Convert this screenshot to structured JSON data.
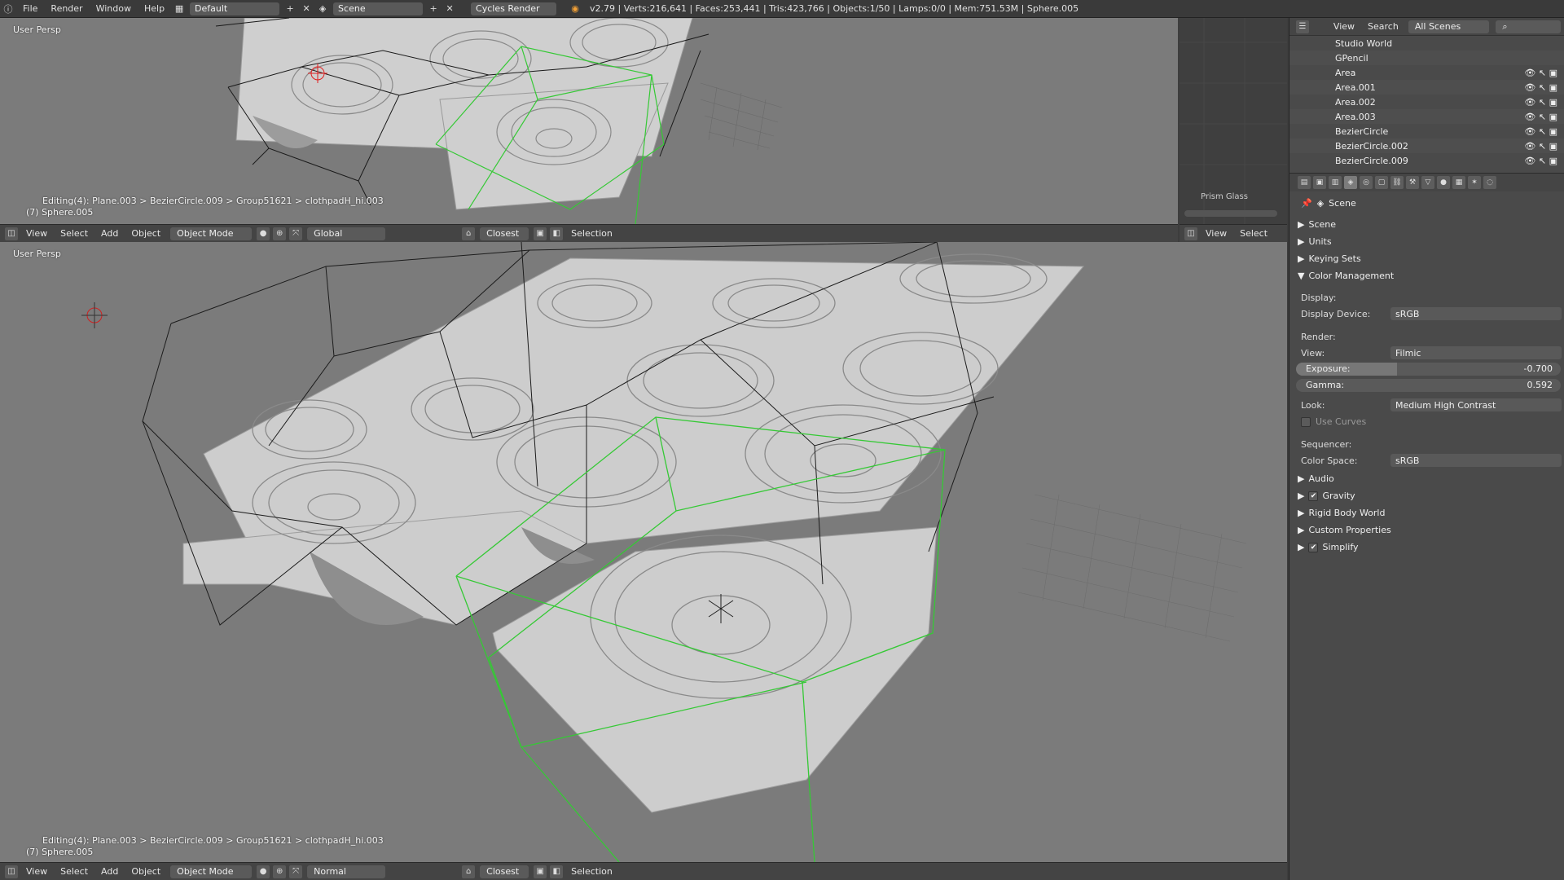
{
  "topbar": {
    "menus": [
      "File",
      "Render",
      "Window",
      "Help"
    ],
    "layout": "Default",
    "scene": "Scene",
    "engine": "Cycles Render",
    "stats": "v2.79 | Verts:216,641 | Faces:253,441 | Tris:423,766 | Objects:1/50 | Lamps:0/0 | Mem:751.53M | Sphere.005"
  },
  "viewport_top": {
    "label": "User Persp",
    "status_line1": "Editing(4): Plane.003 > BezierCircle.009 > Group51621 > clothpadH_hi.003",
    "status_line2": "(7) Sphere.005",
    "header": {
      "view": "View",
      "select": "Select",
      "add": "Add",
      "object": "Object",
      "mode": "Object Mode",
      "orientation": "Global",
      "snap": "Closest",
      "selection": "Selection"
    }
  },
  "viewport_bottom": {
    "label": "User Persp",
    "status_line1": "Editing(4): Plane.003 > BezierCircle.009 > Group51621 > clothpadH_hi.003",
    "status_line2": "(7) Sphere.005",
    "header": {
      "view": "View",
      "select": "Select",
      "add": "Add",
      "object": "Object",
      "mode": "Object Mode",
      "orientation": "Normal",
      "snap": "Closest",
      "selection": "Selection"
    }
  },
  "sideview": {
    "label": "Prism Glass",
    "header_view": "View",
    "header_select": "Select"
  },
  "outliner": {
    "header_view": "View",
    "header_search": "Search",
    "header_scope": "All Scenes",
    "items": [
      {
        "name": "Studio World"
      },
      {
        "name": "GPencil"
      },
      {
        "name": "Area"
      },
      {
        "name": "Area.001"
      },
      {
        "name": "Area.002"
      },
      {
        "name": "Area.003"
      },
      {
        "name": "BezierCircle"
      },
      {
        "name": "BezierCircle.002"
      },
      {
        "name": "BezierCircle.009"
      }
    ]
  },
  "properties": {
    "context": "Scene",
    "panels": {
      "scene": "Scene",
      "units": "Units",
      "keying_sets": "Keying Sets",
      "color_management": "Color Management",
      "audio": "Audio",
      "gravity": "Gravity",
      "rigid_body_world": "Rigid Body World",
      "custom_properties": "Custom Properties",
      "simplify": "Simplify"
    },
    "display_label": "Display:",
    "display_device_label": "Display Device:",
    "display_device": "sRGB",
    "render_label": "Render:",
    "view_label": "View:",
    "view": "Filmic",
    "exposure_label": "Exposure:",
    "exposure": "-0.700",
    "exposure_fill": 0.38,
    "gamma_label": "Gamma:",
    "gamma": "0.592",
    "gamma_fill": 0.0,
    "look_label": "Look:",
    "look": "Medium High Contrast",
    "use_curves": "Use Curves",
    "sequencer_label": "Sequencer:",
    "color_space_label": "Color Space:",
    "color_space": "sRGB"
  },
  "colors": {
    "viewport_bg": "#7b7b7b",
    "selection_green": "#35c935",
    "panel_bg": "#4a4a4a"
  }
}
